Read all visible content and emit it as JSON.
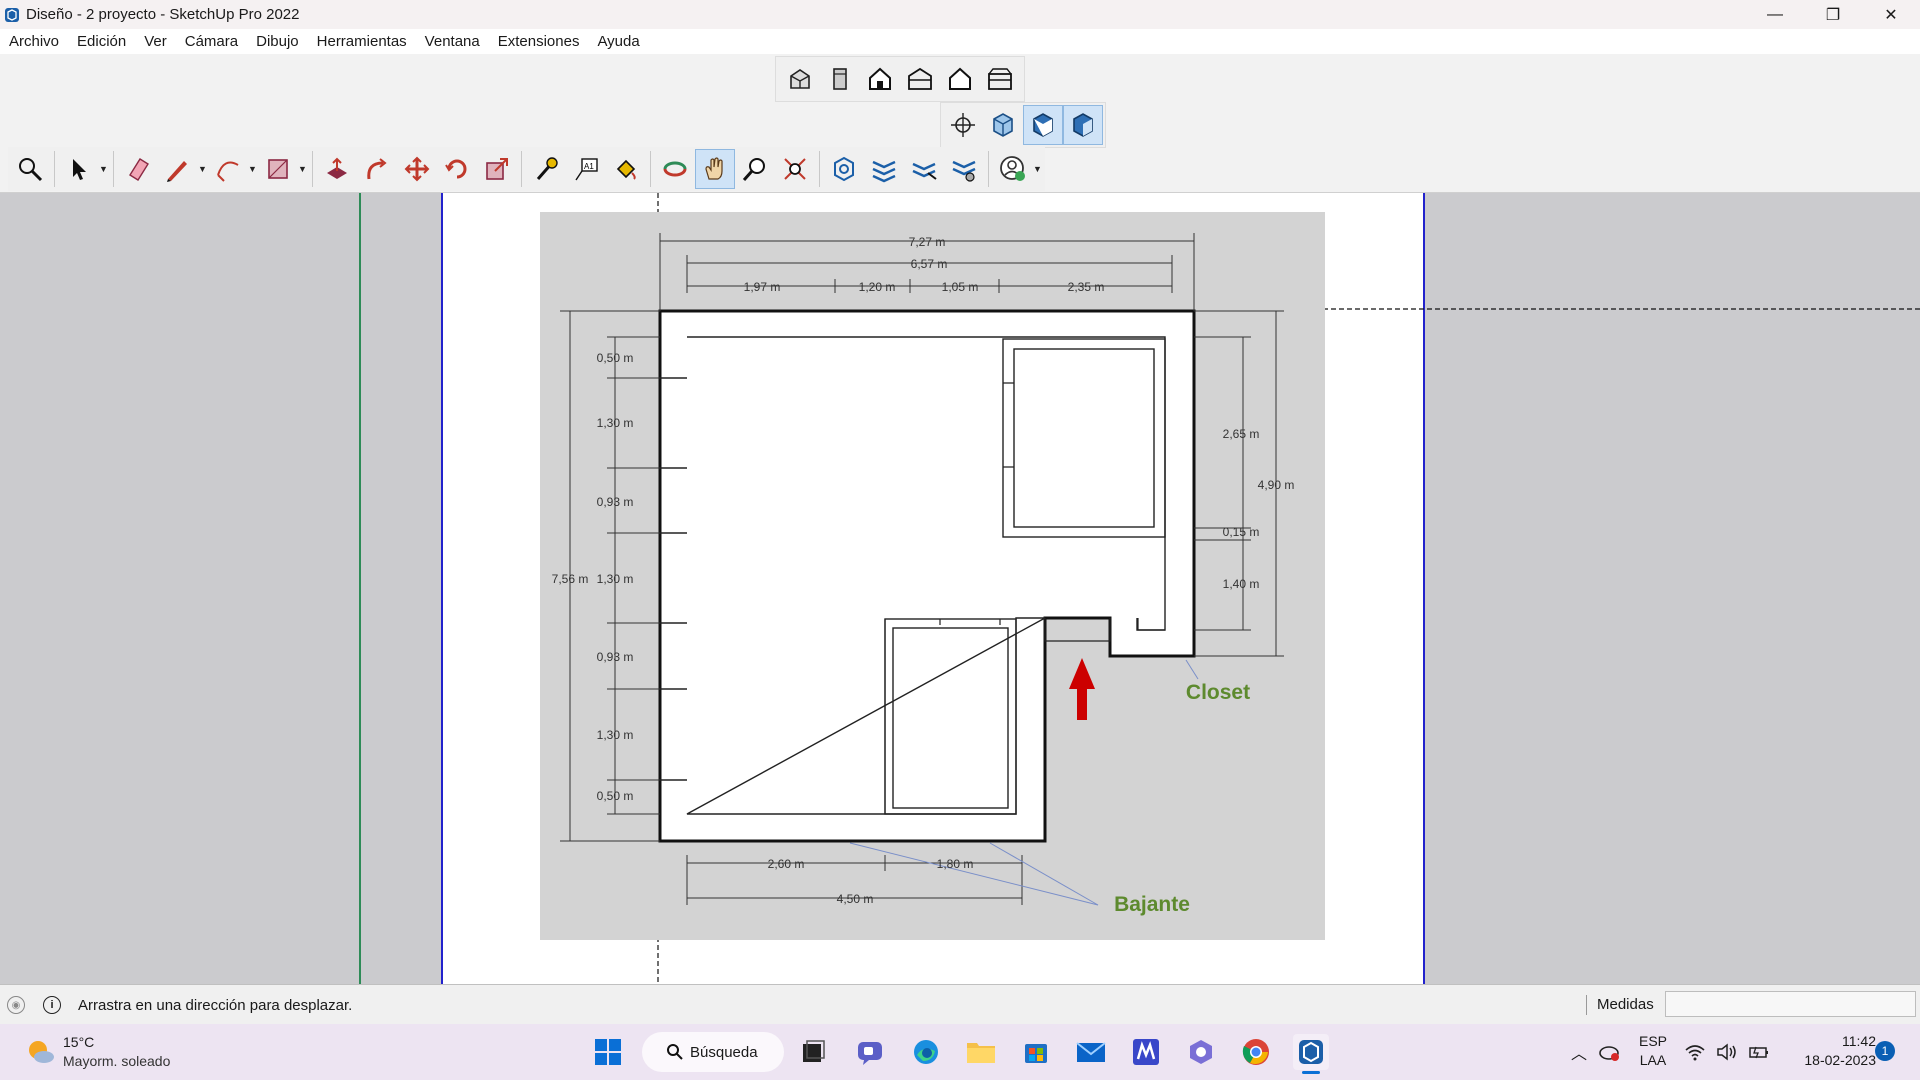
{
  "window": {
    "title": "Diseño - 2 proyecto - SketchUp Pro 2022",
    "minimize": "—",
    "maximize": "❐",
    "close": "✕"
  },
  "menu": [
    "Archivo",
    "Edición",
    "Ver",
    "Cámara",
    "Dibujo",
    "Herramientas",
    "Ventana",
    "Extensiones",
    "Ayuda"
  ],
  "plan": {
    "top_dims": [
      "7,27 m",
      "6,57 m",
      "1,97 m",
      "1,20 m",
      "1,05 m",
      "2,35 m"
    ],
    "left_dims": [
      "0,50 m",
      "1,30 m",
      "0,93 m",
      "1,30 m",
      "0,93 m",
      "1,30 m",
      "0,50 m"
    ],
    "left_total": "7,56 m",
    "right_dims": [
      "2,65 m",
      "0,15 m",
      "1,40 m"
    ],
    "right_total": "4,90 m",
    "bottom_dims": [
      "2,60 m",
      "1,80 m",
      "4,50 m"
    ],
    "label_closet": "Closet",
    "label_bajante": "Bajante",
    "label_color": "#5d8a2e",
    "arrow_color": "#cc0000"
  },
  "status": {
    "message": "Arrastra en una dirección para desplazar.",
    "measures_label": "Medidas",
    "measures_value": ""
  },
  "taskbar": {
    "weather_temp": "15°C",
    "weather_desc": "Mayorm. soleado",
    "search": "Búsqueda",
    "lang1": "ESP",
    "lang2": "LAA",
    "time": "11:42",
    "date": "18-02-2023",
    "notifications": "1"
  }
}
